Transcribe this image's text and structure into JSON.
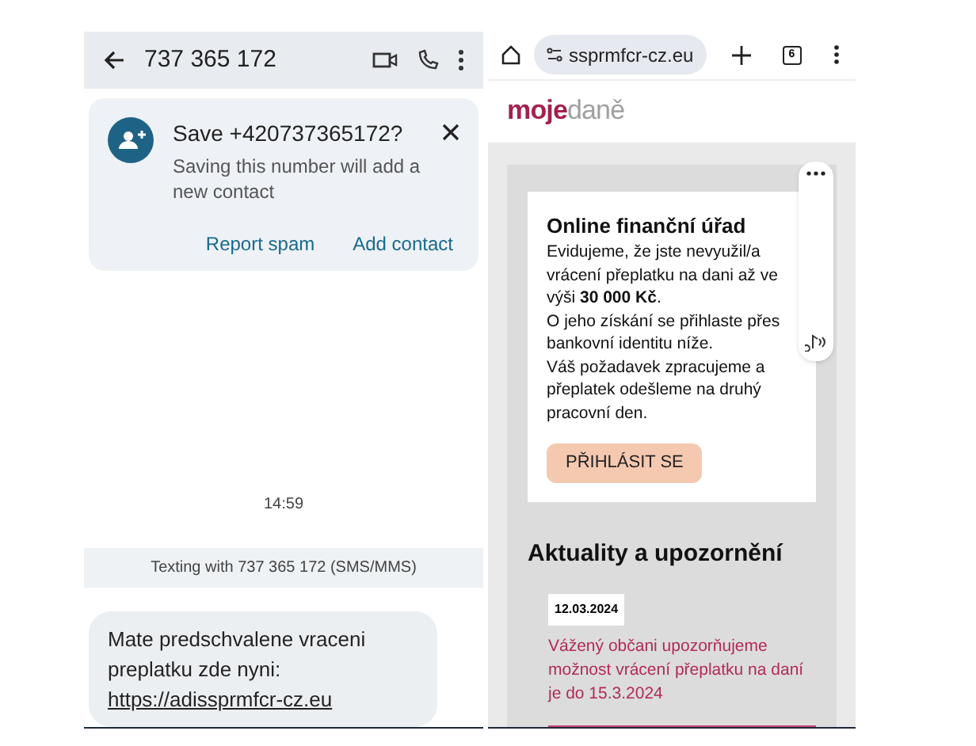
{
  "messages_app": {
    "header": {
      "title": "737 365 172"
    },
    "save_card": {
      "title": "Save +420737365172?",
      "text": "Saving this number will add a new contact",
      "actions": [
        "Report spam",
        "Add contact"
      ]
    },
    "timestamp": "14:59",
    "info_bar": "Texting with 737 365 172 (SMS/MMS)",
    "message": {
      "text": "Mate predschvalene vraceni preplatku zde nyni:",
      "link": "https://adissprmfcr-cz.eu"
    }
  },
  "browser": {
    "url": "ssprmfcr-cz.eu",
    "tab_count": "6",
    "logo": {
      "part_1": "moje",
      "part_2": "daně"
    },
    "card": {
      "title": "Online finanční úřad",
      "paragraphs": [
        "Evidujeme, že jste nevyužil/a vrácení přeplatku na dani až ve výši **30 000 Kč**.",
        "O jeho získání se přihlaste přes bankovní identitu níže.",
        "Váš požadavek zpracujeme a přeplatek odešleme na druhý pracovní den."
      ],
      "button": "PŘIHLÁSIT SE"
    },
    "news": {
      "heading": "Aktuality a upozornění",
      "items": [
        {
          "date": "12.03.2024",
          "text": "Vážený občani upozorňujeme možnost vrácení přeplatku na daní je do 15.3.2024"
        }
      ]
    }
  }
}
